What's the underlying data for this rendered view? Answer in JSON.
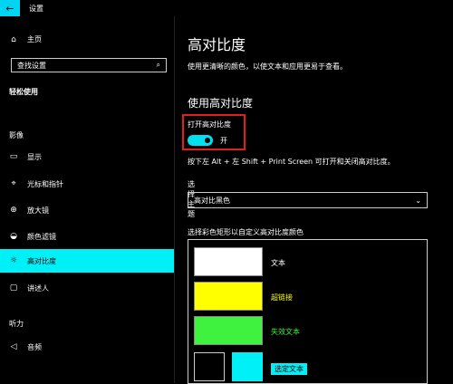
{
  "titlebar": {
    "back_icon": "←",
    "title": "设置"
  },
  "sidebar": {
    "home": {
      "icon": "⌂",
      "label": "主页"
    },
    "search": {
      "placeholder": "查找设置",
      "icon": "⌕"
    },
    "section_title": "轻松使用",
    "category_vision": "影像",
    "items": [
      {
        "icon": "▭",
        "label": "显示"
      },
      {
        "icon": "⌖",
        "label": "光标和指针"
      },
      {
        "icon": "⊕",
        "label": "放大镜"
      },
      {
        "icon": "◒",
        "label": "颜色滤镜"
      },
      {
        "icon": "☼",
        "label": "高对比度"
      },
      {
        "icon": "▢",
        "label": "讲述人"
      }
    ],
    "category_hearing": "听力",
    "hearing_items": [
      {
        "icon": "◁",
        "label": "音频"
      }
    ]
  },
  "main": {
    "title": "高对比度",
    "description": "使用更清晰的颜色，以使文本和应用更易于查看。",
    "subtitle": "使用高对比度",
    "toggle_label": "打开高对比度",
    "toggle_state": "开",
    "shortcut_hint": "按下左 Alt + 左 Shift + Print Screen 可打开和关闭高对比度。",
    "theme_label": "选择主题",
    "theme_value": "高对比黑色",
    "theme_chevron": "⌄",
    "swatch_title": "选择彩色矩形以自定义高对比度颜色",
    "swatches": [
      {
        "label": "文本",
        "color": "#ffffff"
      },
      {
        "label": "超链接",
        "color": "#ffff00"
      },
      {
        "label": "失效文本",
        "color": "#3ff23f"
      }
    ],
    "selected_text": "选定文本"
  },
  "colors": {
    "accent": "#00f0f8",
    "highlight_border": "#e02020"
  }
}
